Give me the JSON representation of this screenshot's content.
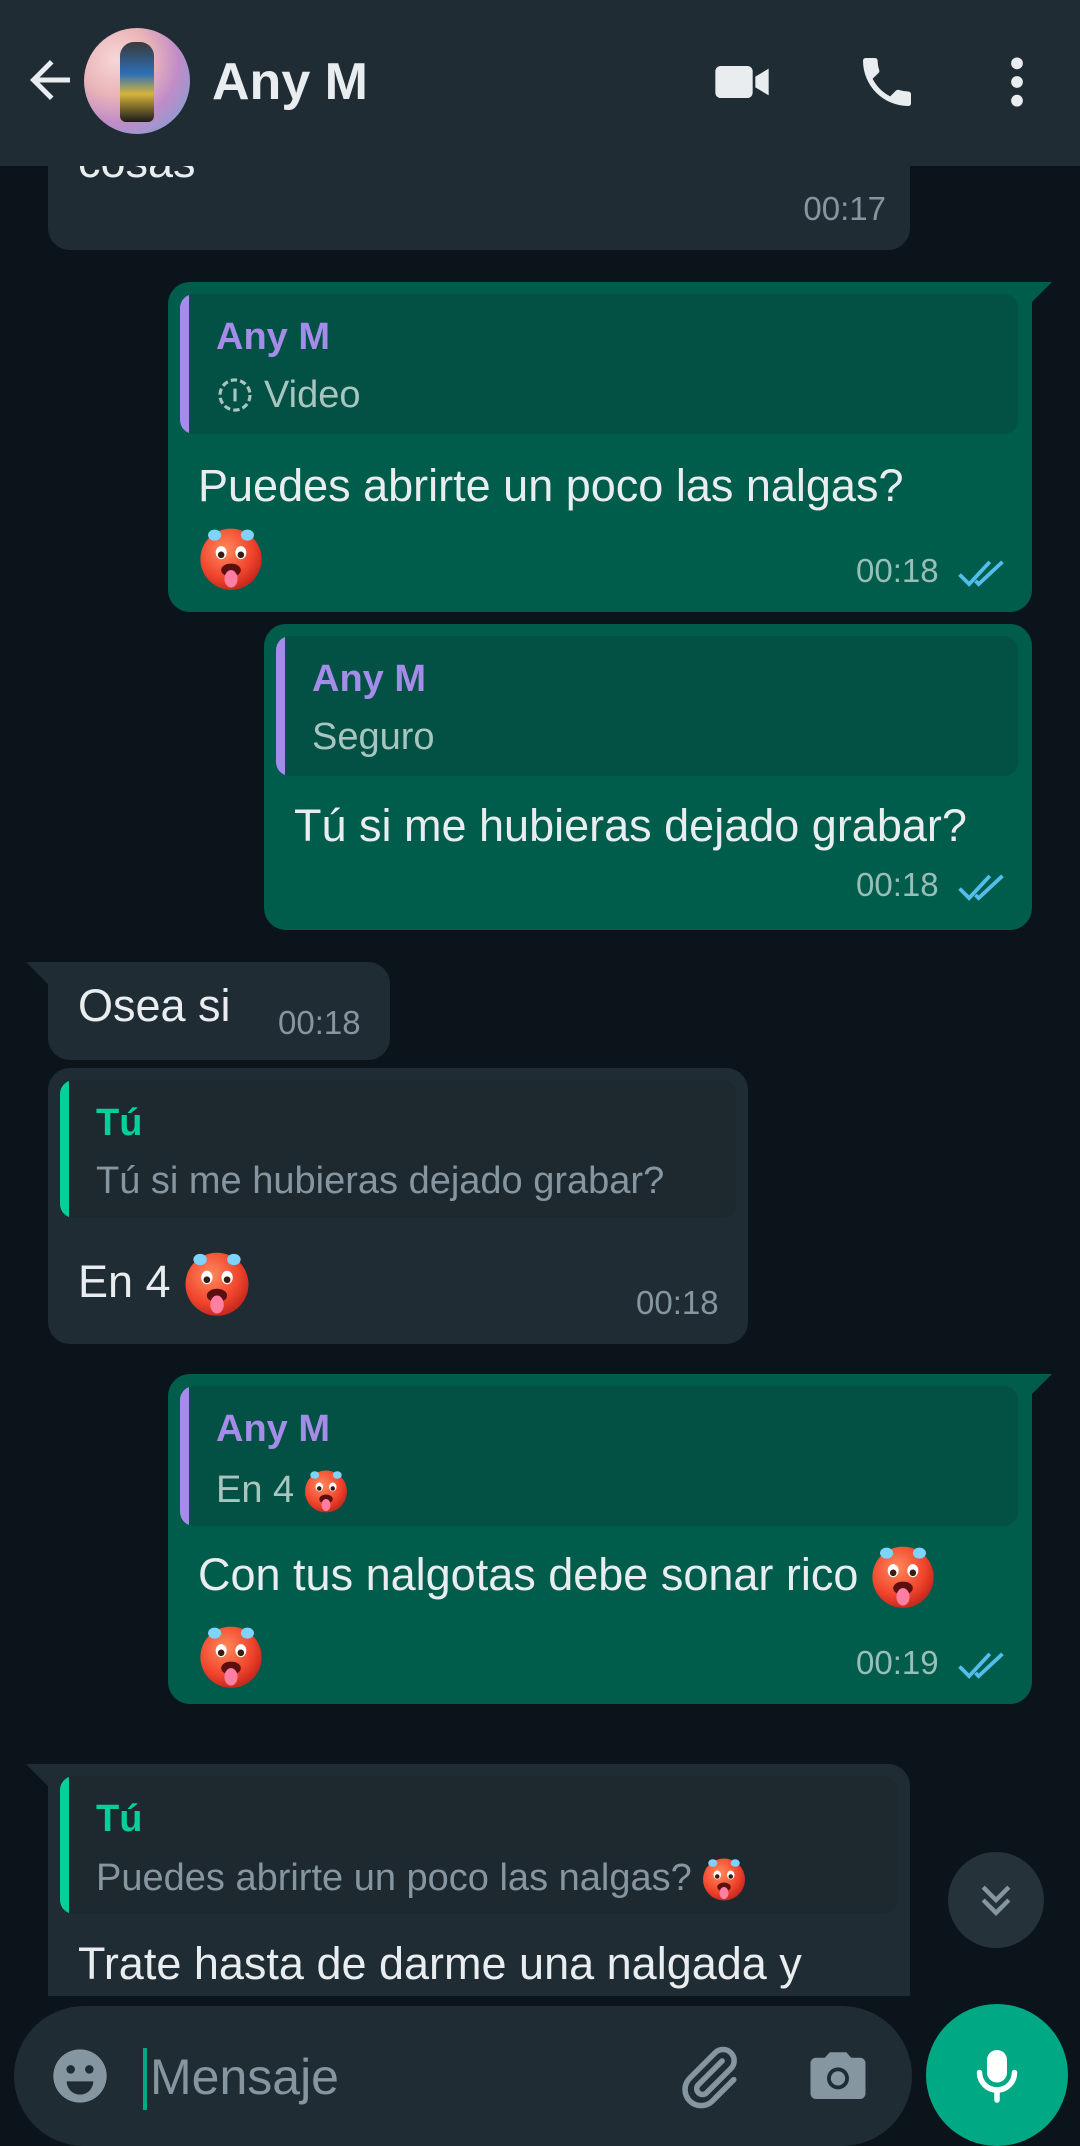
{
  "header": {
    "contact_name": "Any M",
    "icons": [
      "back-arrow-icon",
      "avatar",
      "video-call-icon",
      "phone-icon",
      "more-vert-icon"
    ]
  },
  "colors": {
    "header_bg": "#1f2c34",
    "chat_bg": "#0b141a",
    "incoming_bubble": "#202c33",
    "outgoing_bubble": "#005c4b",
    "accent": "#00a884",
    "read_ticks": "#53bdeb",
    "quote_author_contact": "#a48ce8",
    "quote_author_self": "#06cf9c"
  },
  "messages": [
    {
      "direction": "in",
      "text": "cosas",
      "time": "00:17"
    },
    {
      "direction": "out",
      "quote": {
        "author": "Any M",
        "text": "Video",
        "icon": "view-once-icon"
      },
      "text": "Puedes abrirte un poco las nalgas?",
      "emoji": "hot-face",
      "time": "00:18",
      "status": "read"
    },
    {
      "direction": "out",
      "quote": {
        "author": "Any M",
        "text": "Seguro"
      },
      "text": "Tú si me hubieras dejado grabar?",
      "time": "00:18",
      "status": "read"
    },
    {
      "direction": "in",
      "text": "Osea si",
      "time": "00:18"
    },
    {
      "direction": "in",
      "quote": {
        "author": "Tú",
        "text": "Tú si me hubieras dejado grabar?"
      },
      "text": "En 4",
      "emoji": "hot-face",
      "time": "00:18"
    },
    {
      "direction": "out",
      "quote": {
        "author": "Any M",
        "text": "En 4",
        "emoji": "hot-face"
      },
      "text": "Con tus nalgotas debe sonar rico",
      "emoji": "hot-face",
      "time": "00:19",
      "status": "read"
    },
    {
      "direction": "in",
      "quote": {
        "author": "Tú",
        "text": "Puedes abrirte un poco las nalgas?",
        "emoji": "hot-face"
      },
      "text": "Trate hasta de darme una nalgada y"
    }
  ],
  "composer": {
    "placeholder": "Mensaje",
    "icons": [
      "emoji-icon",
      "attach-icon",
      "camera-icon",
      "mic-icon"
    ]
  },
  "scroll_button": {
    "icon": "double-chevron-down-icon"
  }
}
